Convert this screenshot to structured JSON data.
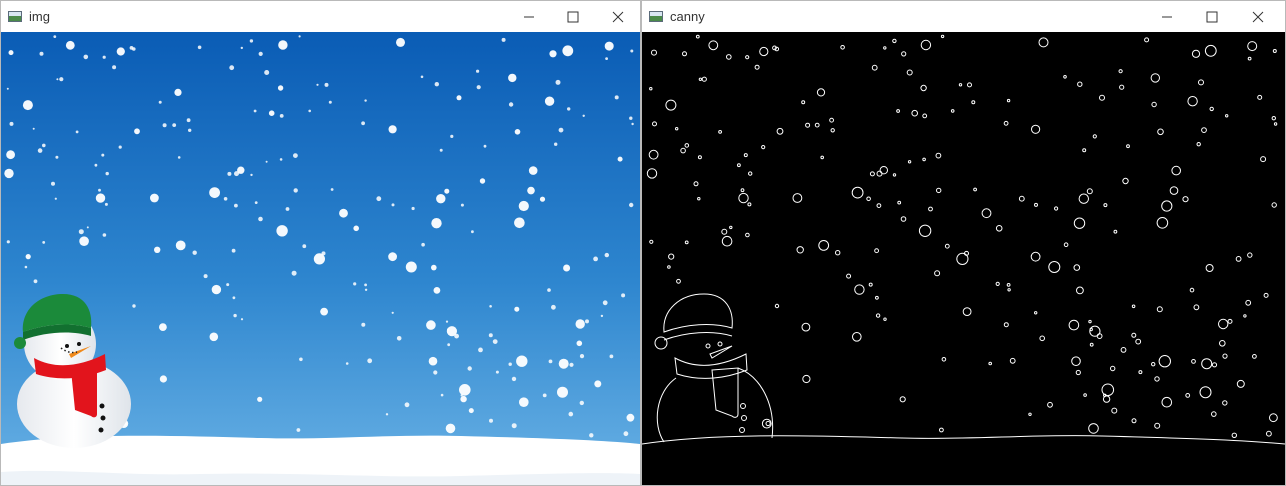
{
  "windows": [
    {
      "title": "img"
    },
    {
      "title": "canny"
    }
  ],
  "colors": {
    "sky_top": "#0a5cb5",
    "sky_mid": "#2e86cf",
    "sky_bottom": "#6ab2e5",
    "snow": "#ffffff",
    "hat": "#1b8a3a",
    "scarf": "#e2141c",
    "nose": "#f08a1c",
    "canny_bg": "#000000",
    "canny_edge": "#ffffff"
  },
  "icons": [
    "app-icon",
    "minimize-icon",
    "maximize-icon",
    "close-icon"
  ]
}
